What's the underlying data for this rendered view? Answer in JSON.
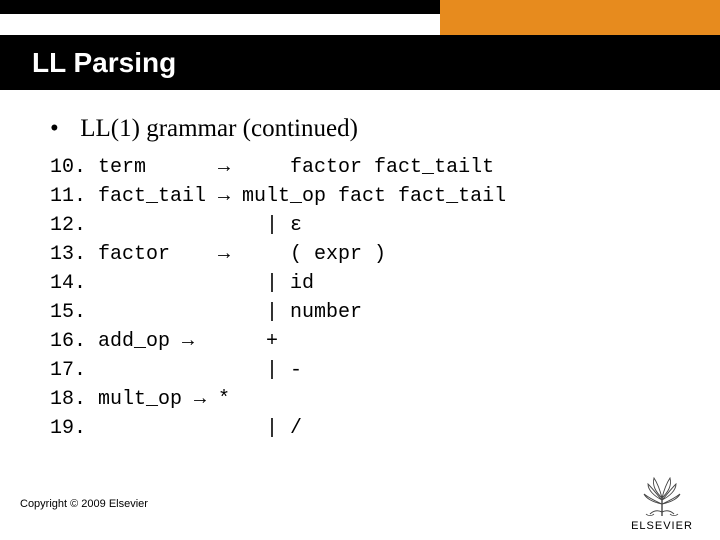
{
  "header": {
    "title": "LL Parsing"
  },
  "bullet": {
    "text": "LL(1) grammar (continued)"
  },
  "grammar": {
    "lines": [
      "10. term      →     factor fact_tailt",
      "11. fact_tail → mult_op fact fact_tail",
      "12.               | ε",
      "13. factor    →     ( expr )",
      "14.               | id",
      "15.               | number",
      "16. add_op →      +",
      "17.               | -",
      "18. mult_op → *",
      "19.               | /"
    ]
  },
  "footer": {
    "copyright": "Copyright © 2009 Elsevier",
    "publisher": "ELSEVIER"
  }
}
